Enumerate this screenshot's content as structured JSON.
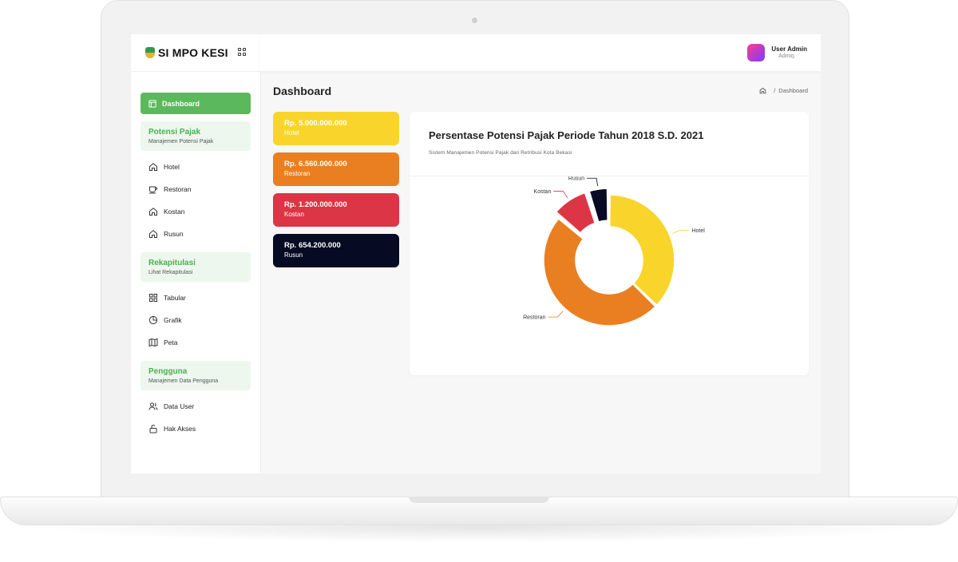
{
  "app": {
    "brand": "SI MPO KESI",
    "logo_icon": "municipal-logo"
  },
  "header": {
    "user_name": "User Admin",
    "user_role": "Admin",
    "avatar_colors": [
      "#ff3c8e",
      "#7b3cff"
    ]
  },
  "sidebar": {
    "active_item": "Dashboard",
    "sections": [
      {
        "title": "Potensi Pajak",
        "subtitle": "Manajemen Potensi Pajak",
        "items": [
          {
            "label": "Hotel",
            "icon": "home-icon"
          },
          {
            "label": "Restoran",
            "icon": "coffee-cup-icon"
          },
          {
            "label": "Kostan",
            "icon": "home-icon"
          },
          {
            "label": "Rusun",
            "icon": "home-icon"
          }
        ]
      },
      {
        "title": "Rekapitulasi",
        "subtitle": "Lihat Rekapitulasi",
        "items": [
          {
            "label": "Tabular",
            "icon": "grid-icon"
          },
          {
            "label": "Grafik",
            "icon": "pie-chart-icon"
          },
          {
            "label": "Peta",
            "icon": "map-icon"
          }
        ]
      },
      {
        "title": "Pengguna",
        "subtitle": "Manajemen Data Pengguna",
        "items": [
          {
            "label": "Data User",
            "icon": "users-icon"
          },
          {
            "label": "Hak Akses",
            "icon": "unlock-icon"
          }
        ]
      }
    ],
    "accent": "#5cb85c"
  },
  "page": {
    "title": "Dashboard",
    "breadcrumb_sep": "/",
    "breadcrumb_current": "Dashboard"
  },
  "stats": [
    {
      "value": "Rp. 5.000.000.000",
      "label": "Hotel",
      "color": "#f9d52b"
    },
    {
      "value": "Rp. 6.560.000.000",
      "label": "Restoran",
      "color": "#ea7f22"
    },
    {
      "value": "Rp. 1.200.000.000",
      "label": "Kostan",
      "color": "#dc3545"
    },
    {
      "value": "Rp. 654.200.000",
      "label": "Rusun",
      "color": "#060b23"
    }
  ],
  "chart_data": {
    "type": "pie",
    "variant": "donut",
    "title": "Persentase Potensi Pajak Periode Tahun 2018 S.D. 2021",
    "subtitle": "Sistem Manajemen Potensi Pajak dan Retribusi Kota Bekasi",
    "categories": [
      "Hotel",
      "Restoran",
      "Kostan",
      "Rusun"
    ],
    "values": [
      5000000000,
      6560000000,
      1200000000,
      654200000
    ],
    "colors": [
      "#f9d52b",
      "#ea7f22",
      "#dc3545",
      "#060b23"
    ]
  }
}
